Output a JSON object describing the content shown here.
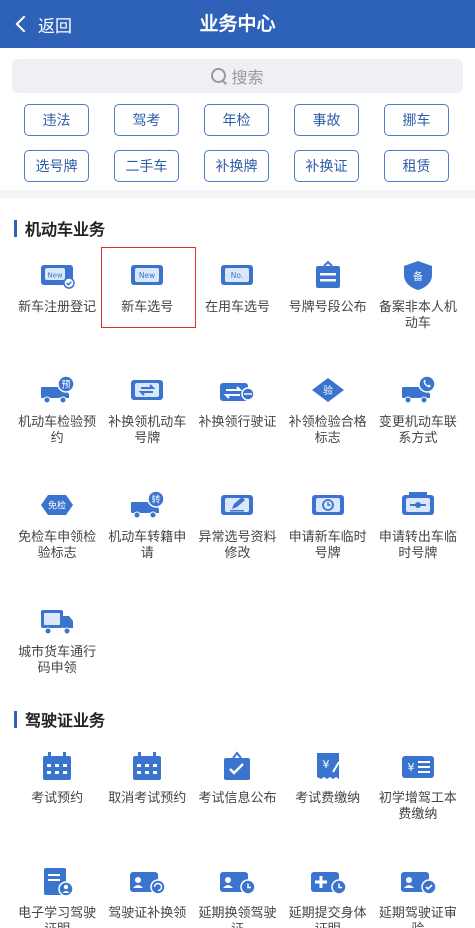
{
  "header": {
    "back_label": "返回",
    "title": "业务中心"
  },
  "search": {
    "placeholder": "搜索"
  },
  "tags": [
    "违法",
    "驾考",
    "年检",
    "事故",
    "挪车",
    "选号牌",
    "二手车",
    "补换牌",
    "补换证",
    "租赁"
  ],
  "sections": [
    {
      "title": "机动车业务",
      "items": [
        {
          "label": "新车注册登记",
          "icon": "new-card-icon"
        },
        {
          "label": "新车选号",
          "icon": "new-plate-icon",
          "selected": true
        },
        {
          "label": "在用车选号",
          "icon": "no-plate-icon"
        },
        {
          "label": "号牌号段公布",
          "icon": "announcement-icon"
        },
        {
          "label": "备案非本人机动车",
          "icon": "record-shield-icon"
        },
        {
          "label": "机动车检验预约",
          "icon": "truck-booking-icon"
        },
        {
          "label": "补换领机动车号牌",
          "icon": "plate-exchange-icon"
        },
        {
          "label": "补换领行驶证",
          "icon": "license-exchange-icon"
        },
        {
          "label": "补领检验合格标志",
          "icon": "inspection-badge-icon"
        },
        {
          "label": "变更机动车联系方式",
          "icon": "truck-phone-icon"
        },
        {
          "label": "免检车申领检验标志",
          "icon": "exempt-badge-icon"
        },
        {
          "label": "机动车转籍申请",
          "icon": "truck-transfer-icon"
        },
        {
          "label": "异常选号资料修改",
          "icon": "edit-plate-icon"
        },
        {
          "label": "申请新车临时号牌",
          "icon": "temp-plate-icon"
        },
        {
          "label": "申请转出车临时号牌",
          "icon": "temp-plate-out-icon"
        },
        {
          "label": "城市货车通行码申领",
          "icon": "cargo-truck-icon"
        }
      ]
    },
    {
      "title": "驾驶证业务",
      "items": [
        {
          "label": "考试预约",
          "icon": "calendar-icon"
        },
        {
          "label": "取消考试预约",
          "icon": "calendar-cancel-icon"
        },
        {
          "label": "考试信息公布",
          "icon": "exam-info-icon"
        },
        {
          "label": "考试费缴纳",
          "icon": "fee-receipt-icon"
        },
        {
          "label": "初学增驾工本费缴纳",
          "icon": "fee-card-icon"
        },
        {
          "label": "电子学习驾驶证明",
          "icon": "e-learning-icon"
        },
        {
          "label": "驾驶证补换领",
          "icon": "license-renew-icon"
        },
        {
          "label": "延期换领驾驶证",
          "icon": "license-delay-icon"
        },
        {
          "label": "延期提交身体证明",
          "icon": "health-proof-icon"
        },
        {
          "label": "延期驾驶证审验",
          "icon": "license-audit-icon"
        }
      ]
    }
  ],
  "colors": {
    "header": "#2e62b8",
    "accent": "#3a74cf",
    "selected_border": "#d9332b"
  }
}
